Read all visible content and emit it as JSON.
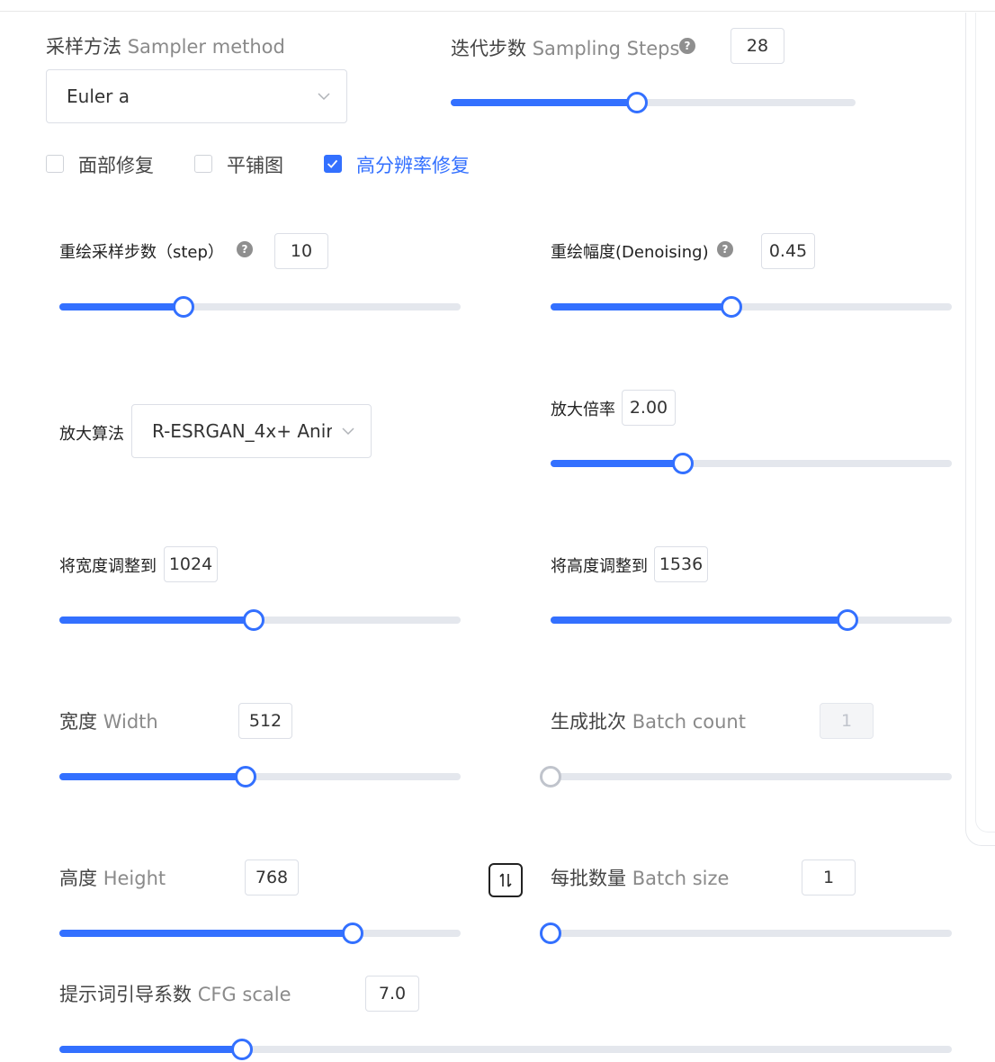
{
  "sampler": {
    "label_zh": "采样方法",
    "label_en": "Sampler method",
    "value": "Euler a"
  },
  "steps": {
    "label_zh": "迭代步数",
    "label_en": "Sampling Steps",
    "value": "28",
    "fraction": 0.46
  },
  "checkboxes": [
    {
      "label": "面部修复",
      "checked": false
    },
    {
      "label": "平铺图",
      "checked": false
    },
    {
      "label": "高分辨率修复",
      "checked": true
    }
  ],
  "hires": {
    "redraw_steps": {
      "label": "重绘采样步数（step）",
      "value": "10",
      "fraction": 0.31
    },
    "denoising": {
      "label": "重绘幅度(Denoising)",
      "value": "0.45",
      "fraction": 0.45
    },
    "upscaler": {
      "label": "放大算法",
      "value": "R-ESRGAN_4x+ Anir"
    },
    "upscale_by": {
      "label": "放大倍率",
      "value": "2.00",
      "fraction": 0.33
    },
    "resize_width": {
      "label": "将宽度调整到",
      "value": "1024",
      "fraction": 0.485
    },
    "resize_height": {
      "label": "将高度调整到",
      "value": "1536",
      "fraction": 0.74
    }
  },
  "width": {
    "label_zh": "宽度",
    "label_en": "Width",
    "value": "512",
    "fraction": 0.465
  },
  "batch_count": {
    "label_zh": "生成批次",
    "label_en": "Batch count",
    "value": "1",
    "fraction": 0.0,
    "disabled": true
  },
  "height": {
    "label_zh": "高度",
    "label_en": "Height",
    "value": "768",
    "fraction": 0.73
  },
  "batch_size": {
    "label_zh": "每批数量",
    "label_en": "Batch size",
    "value": "1",
    "fraction": 0.0
  },
  "cfg": {
    "label_zh": "提示词引导系数",
    "label_en": "CFG scale",
    "value": "7.0",
    "fraction": 0.205
  },
  "colors": {
    "accent": "#3370ff",
    "track": "#e4e7ed",
    "disabled": "#c0c4cc"
  },
  "icons": {
    "help": "question-circle-icon",
    "chevron": "chevron-down-icon",
    "swap": "swap-vertical-icon",
    "check": "check-icon"
  }
}
